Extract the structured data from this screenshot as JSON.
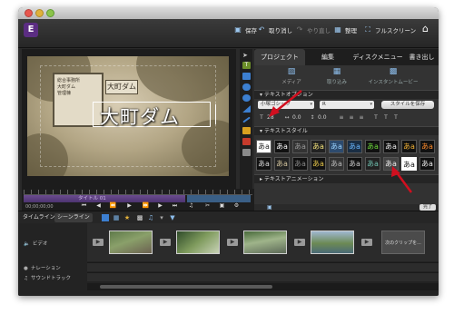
{
  "window": {
    "traffic_lights": [
      "close",
      "minimize",
      "zoom"
    ]
  },
  "toolbar": {
    "save": "保存",
    "undo": "取り消し",
    "redo": "やり直し",
    "organize": "整理",
    "fullscreen": "フルスクリーン"
  },
  "preview": {
    "title_text": "大町ダム",
    "sign_text": "大町ダム",
    "monument_text": "総合事務所\n大町ダム\n管理棟"
  },
  "panel": {
    "tabs": [
      "プロジェクト",
      "編集",
      "ディスクメニュー",
      "書き出し"
    ],
    "subtabs": [
      "メディア",
      "取り込み",
      "インスタントムービー"
    ],
    "text_options_header": "テキストオプション",
    "font_value": "小塚ゴシック",
    "font_style_value": "R",
    "save_style_button": "スタイルを保存",
    "font_size": "28",
    "tracking": "0.0",
    "leading": "0.0",
    "text_style_header": "テキストスタイル",
    "style_glyph": "あa",
    "text_animation_header": "テキストアニメーション",
    "done_button": "完了"
  },
  "scrubber": {
    "clip_label": "タイトル 01",
    "timecode": "00;00;00;00"
  },
  "timeline": {
    "tabs": [
      "タイムライン",
      "シーンライン"
    ],
    "video_label": "ビデオ",
    "narration_label": "ナレーション",
    "soundtrack_label": "サウンドトラック",
    "next_clip_label": "次のクリップを..."
  },
  "annotations": {
    "arrow_color": "#d10f1f"
  },
  "colors": {
    "title_clip": "#6b4b8f",
    "accent": "#8cbcea"
  }
}
